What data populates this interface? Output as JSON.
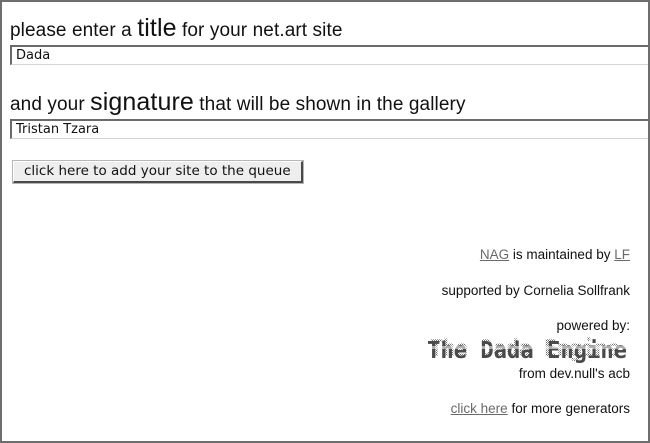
{
  "form": {
    "title_prompt": {
      "before": "please enter a",
      "keyword": "title",
      "after": "for your net.art site"
    },
    "title_value": "Dada",
    "signature_prompt": {
      "before": "and your",
      "keyword": "signature",
      "after": "that will be shown in the gallery"
    },
    "signature_value": "Tristan Tzara",
    "submit_label": "click here to add your site to the queue"
  },
  "credits": {
    "nag_link": "NAG",
    "maintained_text": "is maintained by",
    "lf_link": "LF",
    "supported_text": "supported by Cornelia Sollfrank",
    "powered_text": "powered by:",
    "logo_text": "The Dada Engine",
    "from_text": "from dev.null's acb",
    "click_here_link": "click here",
    "more_text": "for more generators"
  },
  "colors": {
    "frame": "#6e6e6e",
    "link": "#6a6a6a",
    "text": "#111111"
  }
}
